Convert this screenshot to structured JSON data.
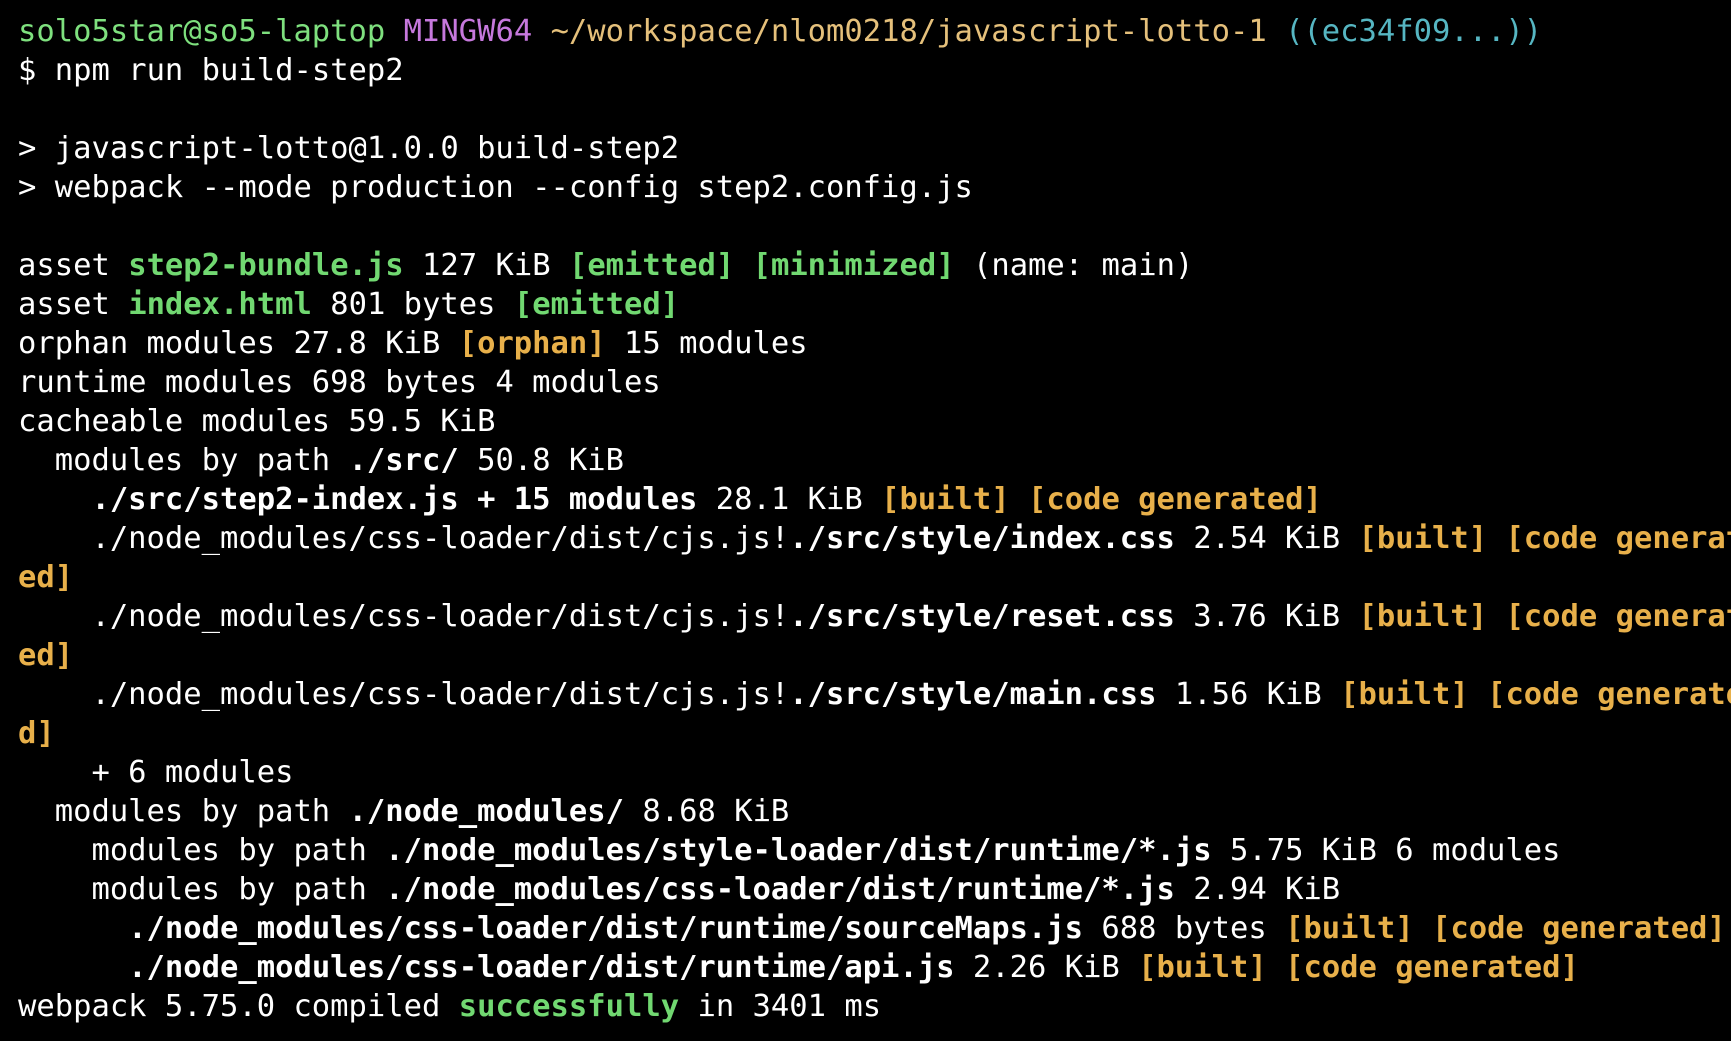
{
  "colors": {
    "background": "#000000",
    "foreground": "#ffffff",
    "user": "#7ee07e",
    "host": "#c678dd",
    "path": "#e5c07b",
    "git": "#56b6c2",
    "green": "#71d871",
    "yellow": "#e8b04a"
  },
  "prompt": {
    "user_host": "solo5star@so5-laptop",
    "shell": "MINGW64",
    "path": "~/workspace/nlom0218/javascript-lotto-1",
    "git_branch": "((ec34f09...))",
    "symbol": "$",
    "command": "npm run build-step2"
  },
  "script": {
    "line1": "> javascript-lotto@1.0.0 build-step2",
    "line2": "> webpack --mode production --config step2.config.js"
  },
  "assets": [
    {
      "prefix": "asset",
      "name": "step2-bundle.js",
      "size": "127 KiB",
      "tags": [
        "[emitted]",
        "[minimized]"
      ],
      "suffix": "(name: main)"
    },
    {
      "prefix": "asset",
      "name": "index.html",
      "size": "801 bytes",
      "tags": [
        "[emitted]"
      ],
      "suffix": ""
    }
  ],
  "orphan": {
    "text1": "orphan modules 27.8 KiB",
    "tag": "[orphan]",
    "text2": "15 modules"
  },
  "runtime": "runtime modules 698 bytes 4 modules",
  "cacheable": "cacheable modules 59.5 KiB",
  "src_group": {
    "label": "modules by path",
    "path": "./src/",
    "size": "50.8 KiB"
  },
  "step2_index": {
    "path": "./src/step2-index.js + 15 modules",
    "size": "28.1 KiB",
    "tag1": "[built]",
    "tag2": "[code generated]"
  },
  "css_modules": [
    {
      "loader": "./node_modules/css-loader/dist/cjs.js!",
      "file": "./src/style/index.css",
      "size": "2.54 KiB",
      "tag1": "[built]",
      "tag2a": "[code generat",
      "tag2b": "ed]"
    },
    {
      "loader": "./node_modules/css-loader/dist/cjs.js!",
      "file": "./src/style/reset.css",
      "size": "3.76 KiB",
      "tag1": "[built]",
      "tag2a": "[code generat",
      "tag2b": "ed]"
    },
    {
      "loader": "./node_modules/css-loader/dist/cjs.js!",
      "file": "./src/style/main.css",
      "size": "1.56 KiB",
      "tag1": "[built]",
      "tag2a": "[code generate",
      "tag2b": "d]"
    }
  ],
  "plus_modules": "+ 6 modules",
  "nm_group": {
    "label": "modules by path",
    "path": "./node_modules/",
    "size": "8.68 KiB"
  },
  "style_loader_group": {
    "label": "modules by path",
    "path": "./node_modules/style-loader/dist/runtime/*.js",
    "size": "5.75 KiB 6 modules"
  },
  "css_loader_group": {
    "label": "modules by path",
    "path": "./node_modules/css-loader/dist/runtime/*.js",
    "size": "2.94 KiB"
  },
  "runtime_files": [
    {
      "path": "./node_modules/css-loader/dist/runtime/sourceMaps.js",
      "size": "688 bytes",
      "tag1": "[built]",
      "tag2": "[code generated]"
    },
    {
      "path": "./node_modules/css-loader/dist/runtime/api.js",
      "size": "2.26 KiB",
      "tag1": "[built]",
      "tag2": "[code generated]"
    }
  ],
  "final": {
    "text1": "webpack 5.75.0 compiled",
    "status": "successfully",
    "text2": "in 3401 ms"
  }
}
